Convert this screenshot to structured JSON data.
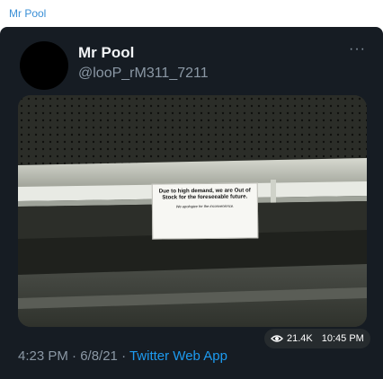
{
  "channel": {
    "title": "Mr Pool"
  },
  "tweet": {
    "display_name": "Mr Pool",
    "handle": "@looP_rM311_7211",
    "more_icon": "more-dots-icon",
    "image": {
      "sign_text": "Due to high demand, we are Out of Stock for the foreseeable future.",
      "sign_subtext": "We apologize for the inconvenience."
    },
    "timestamp": "4:23 PM · 6/8/21 · ",
    "source_app": "Twitter Web App"
  },
  "message_meta": {
    "views_icon": "eye-icon",
    "views": "21.4K",
    "time": "10:45 PM"
  },
  "colors": {
    "card_bg": "#161c23",
    "channel_title": "#3a8fd6",
    "link": "#1d9bf0",
    "muted": "#8b98a5"
  }
}
